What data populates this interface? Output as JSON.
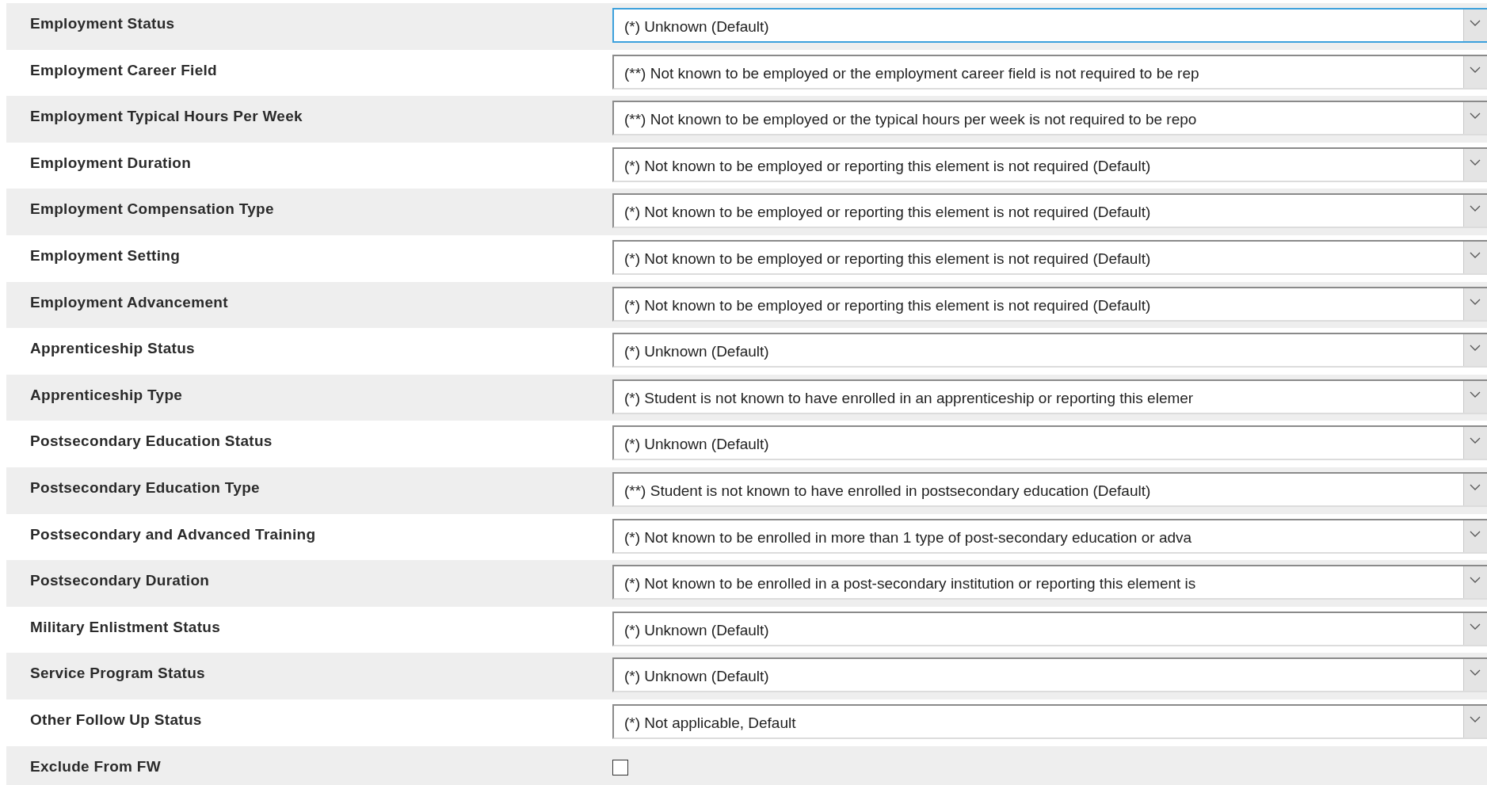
{
  "fields": [
    {
      "label": "Employment Status",
      "kind": "select",
      "value": "(*) Unknown (Default)",
      "focused": true
    },
    {
      "label": "Employment Career Field",
      "kind": "select",
      "value": "(**) Not known to be employed or the employment career field is not required to be rep",
      "focused": false
    },
    {
      "label": "Employment Typical Hours Per Week",
      "kind": "select",
      "value": "(**) Not known to be employed or the typical hours per week is not required to be repo",
      "focused": false
    },
    {
      "label": "Employment Duration",
      "kind": "select",
      "value": "(*) Not known to be employed or reporting this element is not required (Default)",
      "focused": false
    },
    {
      "label": "Employment Compensation Type",
      "kind": "select",
      "value": "(*) Not known to be employed or reporting this element is not required (Default)",
      "focused": false
    },
    {
      "label": "Employment Setting",
      "kind": "select",
      "value": "(*) Not known to be employed or reporting this element is not required (Default)",
      "focused": false
    },
    {
      "label": "Employment Advancement",
      "kind": "select",
      "value": "(*) Not known to be employed or reporting this element is not required (Default)",
      "focused": false
    },
    {
      "label": "Apprenticeship Status",
      "kind": "select",
      "value": "(*) Unknown (Default)",
      "focused": false
    },
    {
      "label": "Apprenticeship Type",
      "kind": "select",
      "value": "(*) Student is not known to have enrolled in an apprenticeship or reporting this elemer",
      "focused": false
    },
    {
      "label": "Postsecondary Education Status",
      "kind": "select",
      "value": "(*) Unknown (Default)",
      "focused": false
    },
    {
      "label": "Postsecondary Education Type",
      "kind": "select",
      "value": "(**) Student is not known to have enrolled in postsecondary education (Default)",
      "focused": false
    },
    {
      "label": "Postsecondary and Advanced Training",
      "kind": "select",
      "value": "(*) Not known to be enrolled in more than 1 type of post-secondary education or adva",
      "focused": false
    },
    {
      "label": "Postsecondary Duration",
      "kind": "select",
      "value": "(*) Not known to be enrolled in a post-secondary institution or reporting this element is",
      "focused": false
    },
    {
      "label": "Military Enlistment Status",
      "kind": "select",
      "value": "(*) Unknown (Default)",
      "focused": false
    },
    {
      "label": "Service Program Status",
      "kind": "select",
      "value": "(*) Unknown (Default)",
      "focused": false
    },
    {
      "label": "Other Follow Up Status",
      "kind": "select",
      "value": "(*) Not applicable, Default",
      "focused": false
    },
    {
      "label": "Exclude From FW",
      "kind": "checkbox",
      "checked": false
    }
  ]
}
